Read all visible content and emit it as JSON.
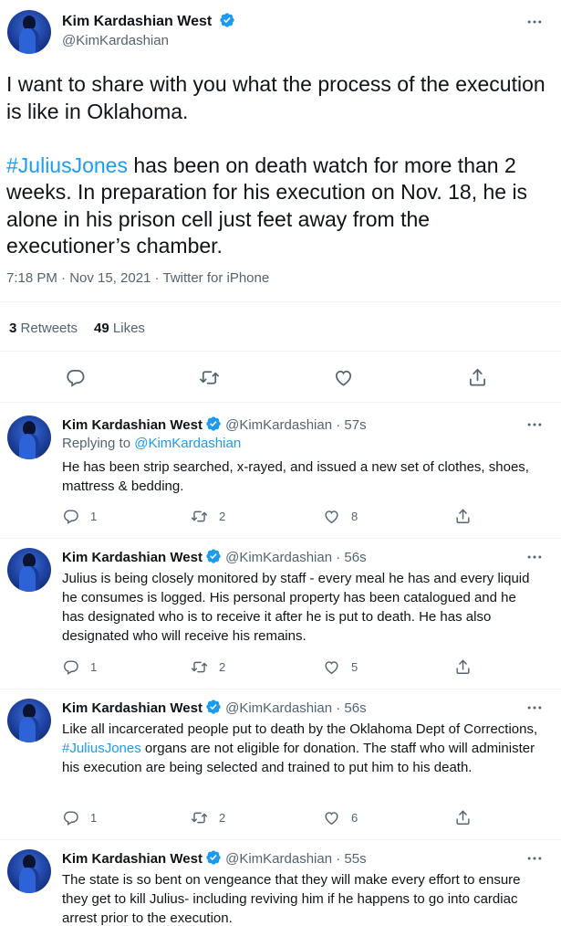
{
  "main": {
    "author_name": "Kim Kardashian West",
    "handle": "@KimKardashian",
    "paragraph1": "I want to share with you what the process of the execution is like in Oklahoma.",
    "hashtag": "#JuliusJones",
    "paragraph2_rest": " has been on death watch for more than 2 weeks. In preparation for his execution on Nov. 18, he is alone in his prison cell just feet away from the executioner’s chamber.",
    "timestamp": "7:18 PM · Nov 15, 2021 · Twitter for iPhone",
    "retweets_count": "3",
    "retweets_label": "Retweets",
    "likes_count": "49",
    "likes_label": "Likes",
    "actions": [
      "reply-icon",
      "retweet-icon",
      "like-icon",
      "share-icon"
    ]
  },
  "replies": [
    {
      "name": "Kim Kardashian West",
      "handle_time": "@KimKardashian · 57s",
      "replying_prefix": "Replying to ",
      "replying_to": "@KimKardashian",
      "text": "He has been strip searched, x-rayed, and issued a new set of clothes, shoes, mattress & bedding.",
      "reply_count": "1",
      "retweet_count": "2",
      "like_count": "8"
    },
    {
      "name": "Kim Kardashian West",
      "handle_time": "@KimKardashian · 56s",
      "text": "Julius is being closely monitored by staff - every meal he has and every liquid he consumes is logged. His personal property has been catalogued and he has designated who is to receive it after he is put to death. He has also designated who will receive his remains.",
      "reply_count": "1",
      "retweet_count": "2",
      "like_count": "5"
    },
    {
      "name": "Kim Kardashian West",
      "handle_time": "@KimKardashian · 56s",
      "text_before": "Like all incarcerated people put to death by the Oklahoma Dept of Corrections, ",
      "hashtag": "#JuliusJones",
      "text_after": " organs are not eligible for donation. The staff who will administer his execution are being selected and trained to put him to his death.",
      "reply_count": "1",
      "retweet_count": "2",
      "like_count": "6"
    },
    {
      "name": "Kim Kardashian West",
      "handle_time": "@KimKardashian · 55s",
      "text": "The state is so bent on vengeance that they will make every effort to ensure they get to kill Julius- including reviving him if he happens to go into cardiac arrest prior to the execution."
    }
  ],
  "colors": {
    "link": "#1d9bf0",
    "verified": "#1d9bf0",
    "secondary_text": "#536471",
    "primary_text": "#0f1419",
    "divider": "#eff3f4"
  }
}
